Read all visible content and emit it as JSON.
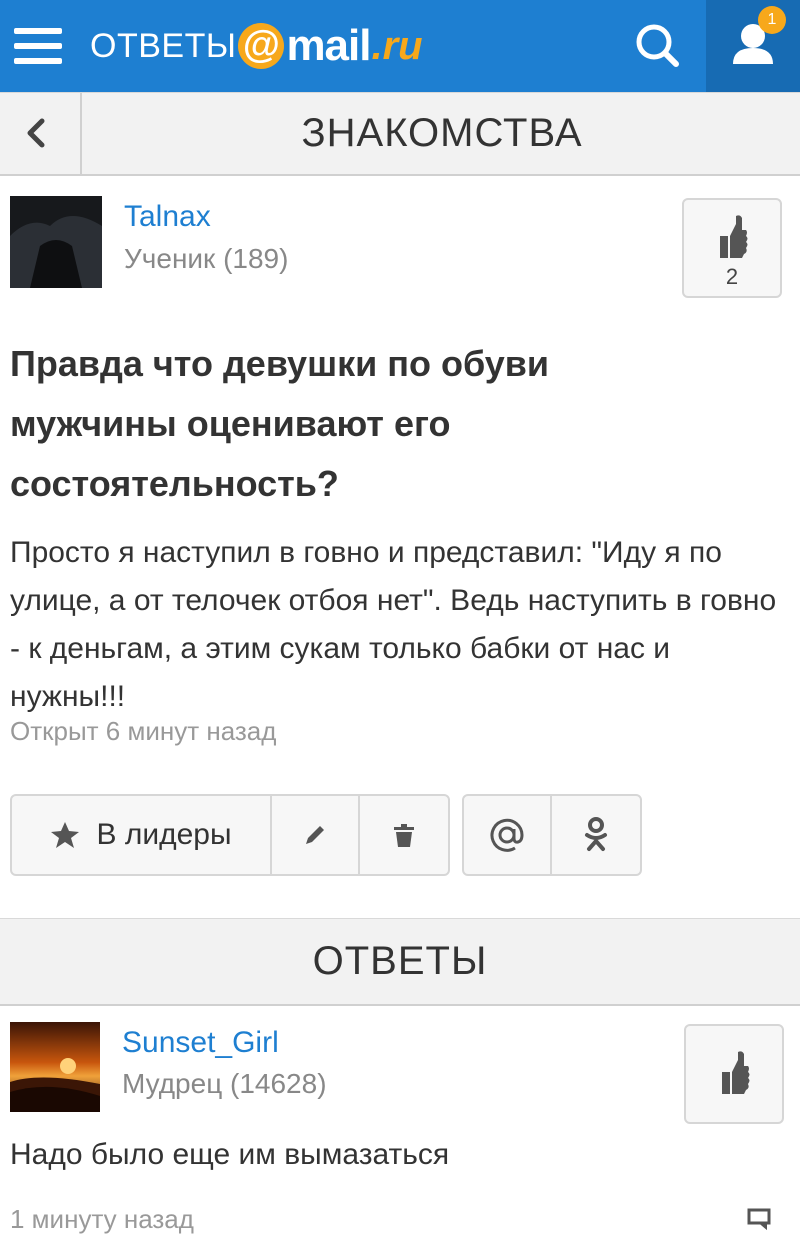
{
  "header": {
    "logo_prefix": "ОТВЕТЫ",
    "logo_at": "@",
    "logo_mail": "mail",
    "logo_ru": ".ru",
    "notification_count": "1",
    "brand_color": "#1e7fd1",
    "accent_color": "#f7a81b"
  },
  "category": {
    "title": "ЗНАКОМСТВА"
  },
  "question": {
    "author": {
      "name": "Talnax",
      "rank": "Ученик (189)"
    },
    "likes": "2",
    "title": "Правда что девушки по обуви мужчины оценивают его состоятельность?",
    "text": "Просто я наступил в говно и представил: \"Иду я по улице, а от телочек отбоя нет\". Ведь наступить в говно - к деньгам, а этим сукам только бабки от нас и нужны!!!",
    "time": "Открыт 6 минут назад"
  },
  "actions": {
    "leader_label": "В лидеры"
  },
  "answers_section": {
    "title": "ОТВЕТЫ"
  },
  "answers": [
    {
      "author": {
        "name": "Sunset_Girl",
        "rank": "Мудрец (14628)"
      },
      "text": "Надо было еще им вымазаться",
      "time": "1 минуту назад"
    }
  ],
  "icons": [
    "menu-icon",
    "search-icon",
    "user-icon",
    "back-chevron-icon",
    "thumbs-up-icon",
    "star-icon",
    "pencil-icon",
    "trash-icon",
    "at-sign-icon",
    "odnoklassniki-icon",
    "comment-icon"
  ]
}
